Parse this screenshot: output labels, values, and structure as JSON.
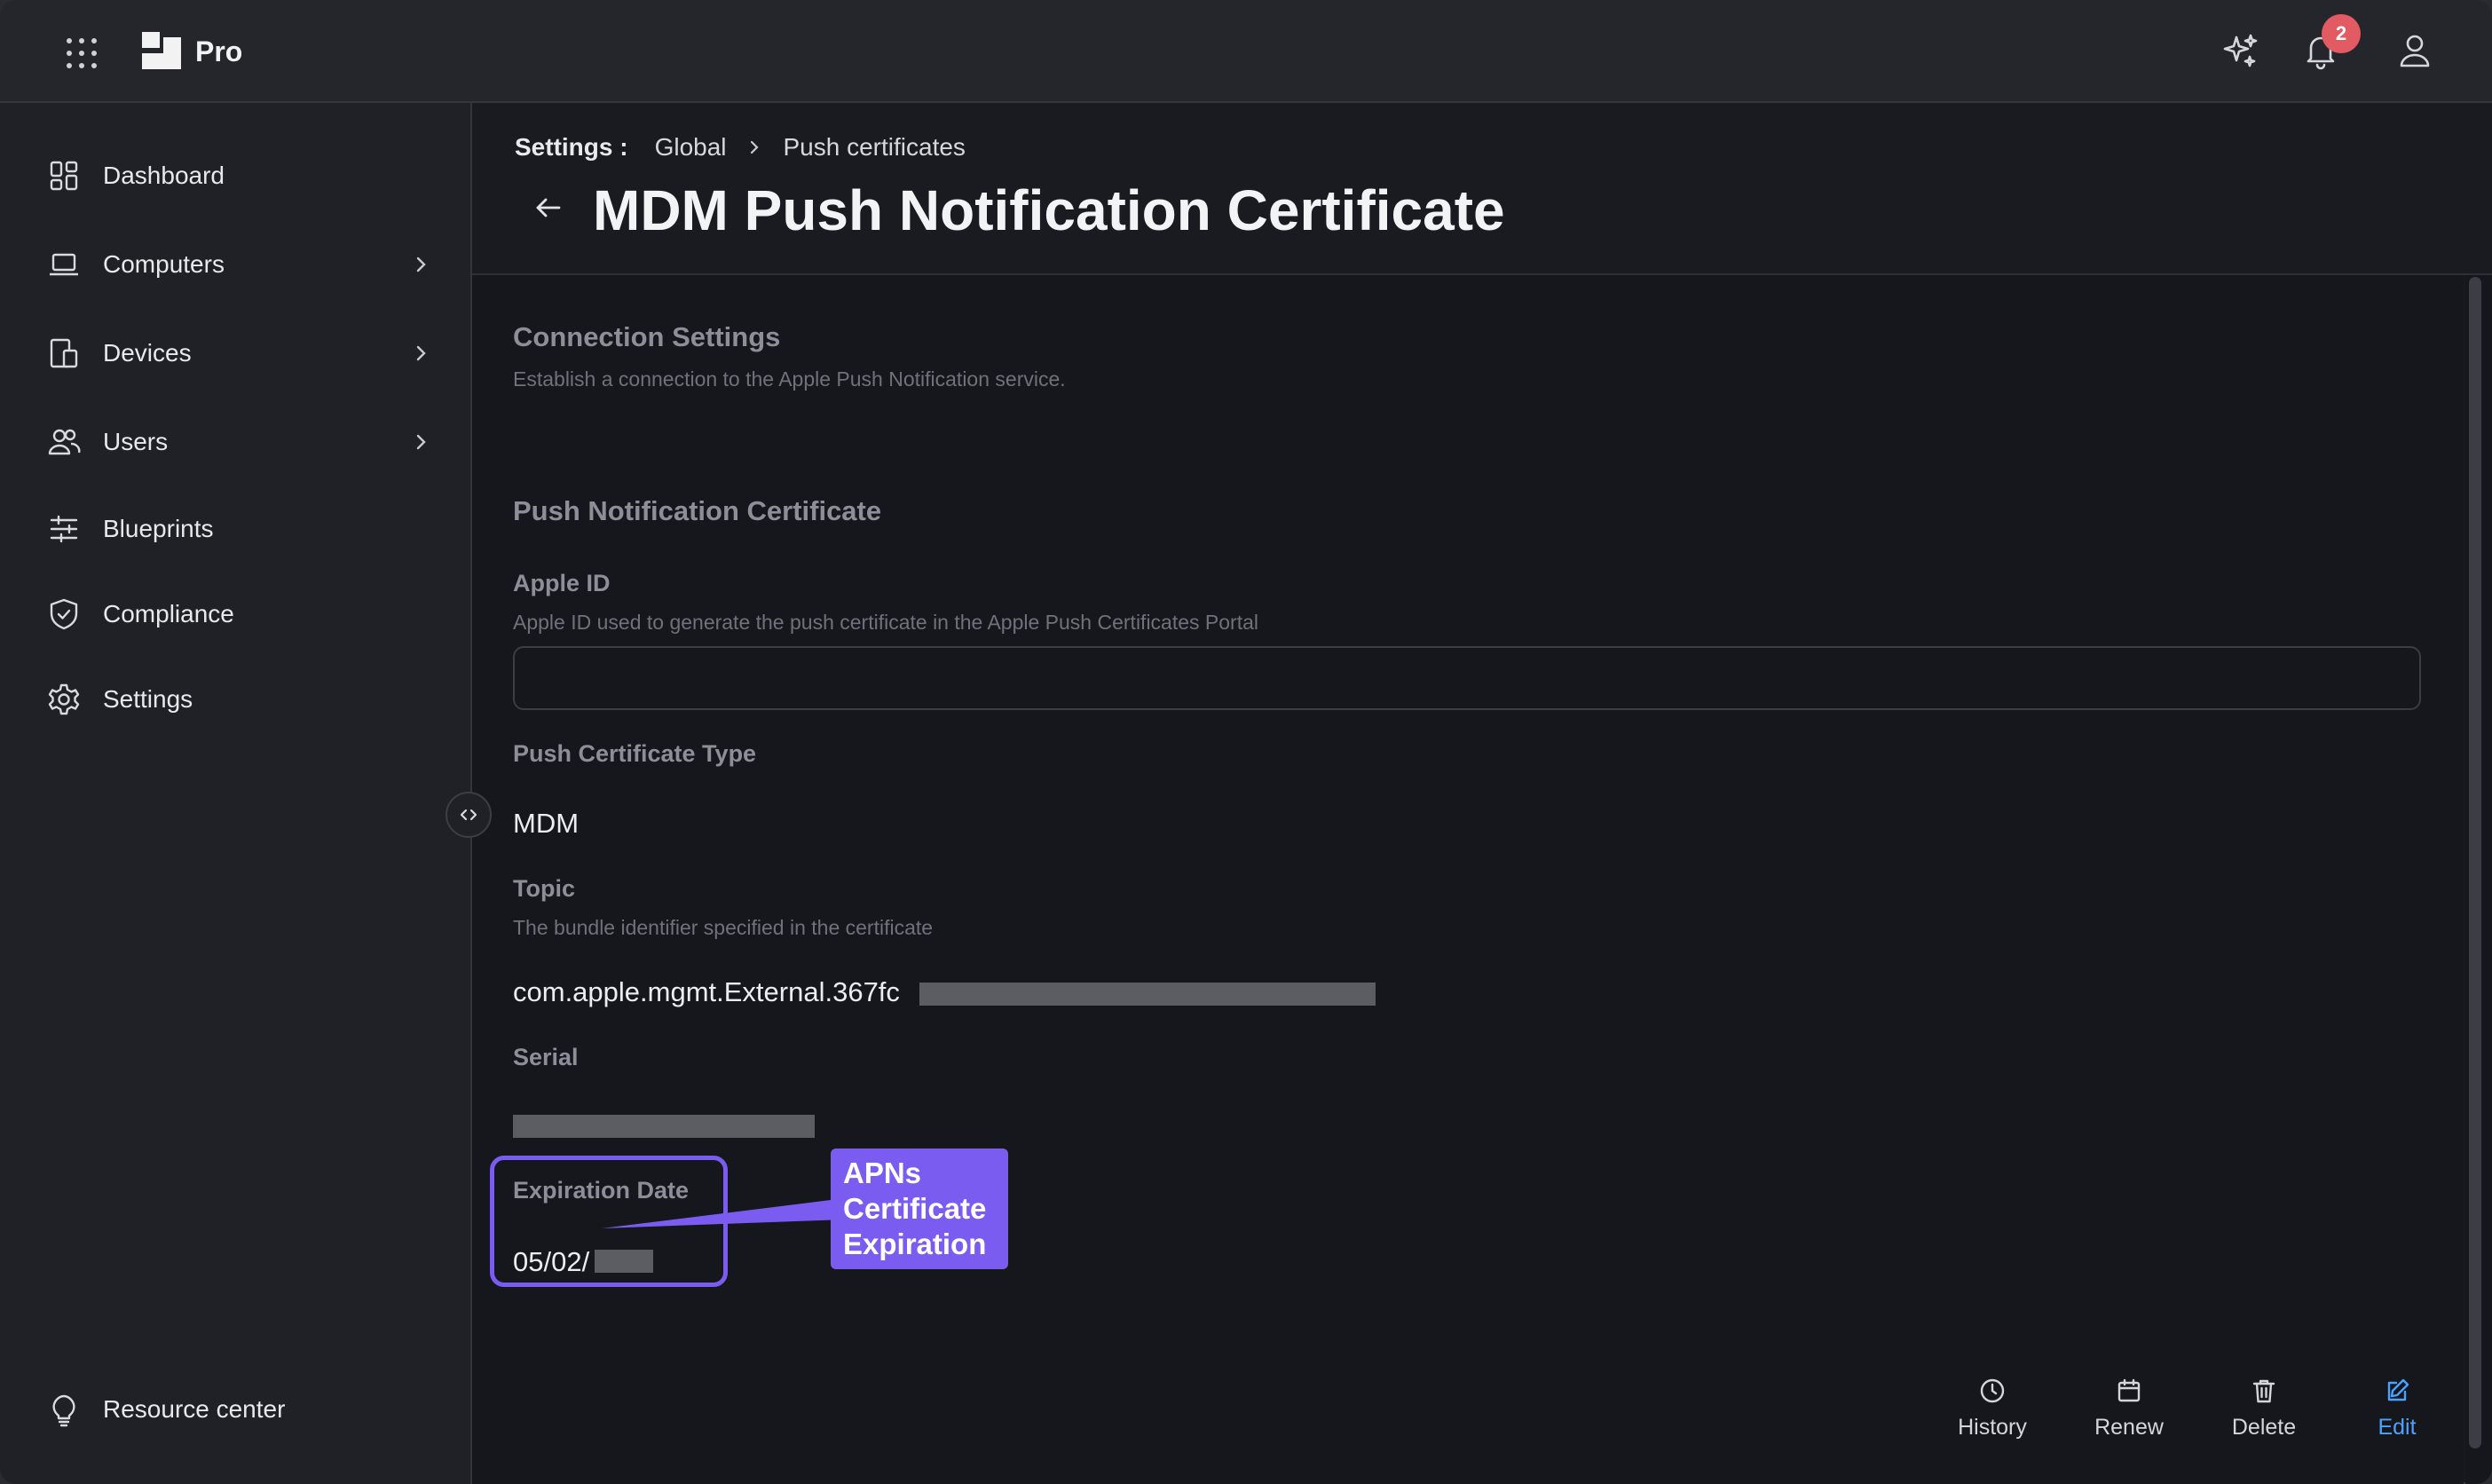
{
  "topbar": {
    "brand": "Pro",
    "notification_count": "2",
    "icons": [
      "apps-grid-icon",
      "sparkle-icon",
      "bell-icon",
      "user-icon"
    ]
  },
  "sidebar": {
    "items": [
      {
        "label": "Dashboard",
        "icon": "dashboard-icon",
        "has_submenu": false
      },
      {
        "label": "Computers",
        "icon": "laptop-icon",
        "has_submenu": true
      },
      {
        "label": "Devices",
        "icon": "devices-icon",
        "has_submenu": true
      },
      {
        "label": "Users",
        "icon": "users-icon",
        "has_submenu": true
      },
      {
        "label": "Blueprints",
        "icon": "sliders-icon",
        "has_submenu": false
      },
      {
        "label": "Compliance",
        "icon": "shield-check-icon",
        "has_submenu": false
      },
      {
        "label": "Settings",
        "icon": "gear-icon",
        "has_submenu": false
      }
    ],
    "footer_item": {
      "label": "Resource center",
      "icon": "lightbulb-icon"
    }
  },
  "header": {
    "breadcrumb_root": "Settings :",
    "breadcrumbs": [
      "Global",
      "Push certificates"
    ],
    "title": "MDM Push Notification Certificate"
  },
  "content": {
    "connection": {
      "title": "Connection Settings",
      "description": "Establish a connection to the Apple Push Notification service."
    },
    "push_section_title": "Push Notification Certificate",
    "apple_id": {
      "label": "Apple ID",
      "description": "Apple ID used to generate the push certificate in the Apple Push Certificates Portal",
      "value": ""
    },
    "cert_type": {
      "label": "Push Certificate Type",
      "value": "MDM"
    },
    "topic": {
      "label": "Topic",
      "description": "The bundle identifier specified in the certificate",
      "value": "com.apple.mgmt.External.367fc"
    },
    "serial": {
      "label": "Serial"
    },
    "expiration": {
      "label": "Expiration Date",
      "value": "05/02/"
    },
    "annotation": "APNs Certificate Expiration"
  },
  "actions": [
    "History",
    "Renew",
    "Delete",
    "Edit"
  ],
  "colors": {
    "accent_purple": "#7a5cf0",
    "edit_blue": "#4aa3ff",
    "badge_red": "#e35b62"
  }
}
